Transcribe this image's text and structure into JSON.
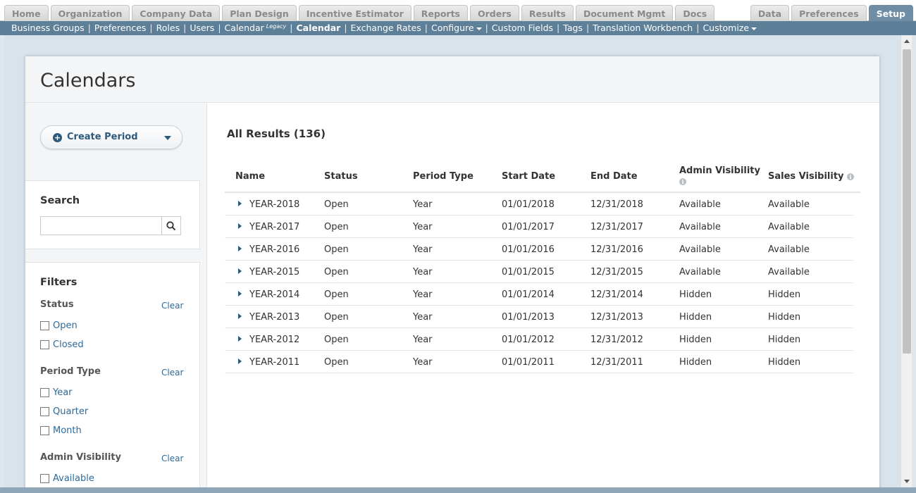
{
  "top_tabs": {
    "left": [
      "Home",
      "Organization",
      "Company Data",
      "Plan Design",
      "Incentive Estimator",
      "Reports",
      "Orders",
      "Results",
      "Document Mgmt",
      "Docs"
    ],
    "right": [
      "Data",
      "Preferences",
      "Setup"
    ],
    "active": "Setup"
  },
  "subnav": {
    "business_groups": "Business Groups",
    "preferences": "Preferences",
    "roles": "Roles",
    "users": "Users",
    "calendar_legacy": "Calendar",
    "legacy_tag": "Legacy",
    "calendar": "Calendar",
    "exchange_rates": "Exchange Rates",
    "configure": "Configure",
    "custom_fields": "Custom Fields",
    "tags": "Tags",
    "translation_workbench": "Translation Workbench",
    "customize": "Customize",
    "separator": "|"
  },
  "page": {
    "title": "Calendars"
  },
  "sidebar": {
    "create_button": "Create Period",
    "search_title": "Search",
    "search_value": "",
    "filters_title": "Filters",
    "clear_label": "Clear",
    "status_title": "Status",
    "status_options": [
      "Open",
      "Closed"
    ],
    "period_type_title": "Period Type",
    "period_type_options": [
      "Year",
      "Quarter",
      "Month"
    ],
    "admin_visibility_title": "Admin Visibility",
    "admin_visibility_options": [
      "Available"
    ]
  },
  "results": {
    "title": "All Results (136)",
    "columns": [
      "Name",
      "Status",
      "Period Type",
      "Start Date",
      "End Date",
      "Admin Visibility",
      "Sales Visibility"
    ],
    "info_glyph": "i",
    "rows": [
      {
        "name": "YEAR-2018",
        "status": "Open",
        "type": "Year",
        "start": "01/01/2018",
        "end": "12/31/2018",
        "admin": "Available",
        "sales": "Available"
      },
      {
        "name": "YEAR-2017",
        "status": "Open",
        "type": "Year",
        "start": "01/01/2017",
        "end": "12/31/2017",
        "admin": "Available",
        "sales": "Available"
      },
      {
        "name": "YEAR-2016",
        "status": "Open",
        "type": "Year",
        "start": "01/01/2016",
        "end": "12/31/2016",
        "admin": "Available",
        "sales": "Available"
      },
      {
        "name": "YEAR-2015",
        "status": "Open",
        "type": "Year",
        "start": "01/01/2015",
        "end": "12/31/2015",
        "admin": "Available",
        "sales": "Available"
      },
      {
        "name": "YEAR-2014",
        "status": "Open",
        "type": "Year",
        "start": "01/01/2014",
        "end": "12/31/2014",
        "admin": "Hidden",
        "sales": "Hidden"
      },
      {
        "name": "YEAR-2013",
        "status": "Open",
        "type": "Year",
        "start": "01/01/2013",
        "end": "12/31/2013",
        "admin": "Hidden",
        "sales": "Hidden"
      },
      {
        "name": "YEAR-2012",
        "status": "Open",
        "type": "Year",
        "start": "01/01/2012",
        "end": "12/31/2012",
        "admin": "Hidden",
        "sales": "Hidden"
      },
      {
        "name": "YEAR-2011",
        "status": "Open",
        "type": "Year",
        "start": "01/01/2011",
        "end": "12/31/2011",
        "admin": "Hidden",
        "sales": "Hidden"
      }
    ]
  },
  "colors": {
    "subnav_bg": "#5d7f97",
    "active_tab": "#6f8ea6",
    "link": "#2d6a9a",
    "brand_dark": "#2d5a7b"
  }
}
